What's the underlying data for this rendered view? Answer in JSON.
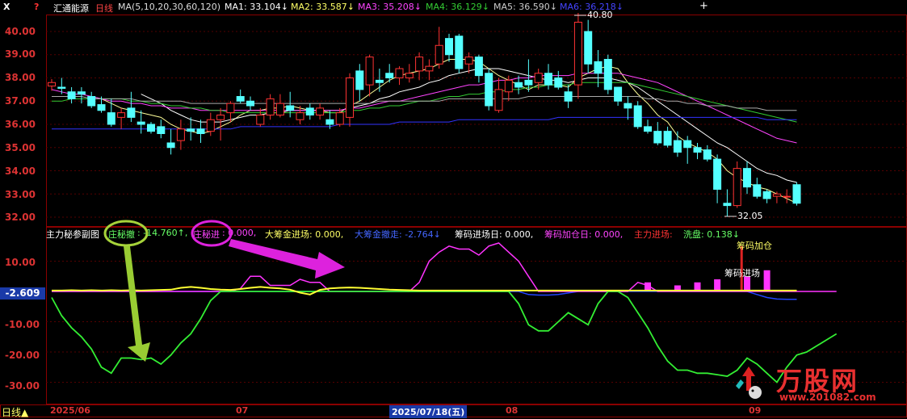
{
  "header": {
    "stock_name": "汇通能源",
    "period": "日线",
    "ma_params": "MA(5,10,20,30,60,120)",
    "ma1": "MA1: 33.104↓",
    "ma2": "MA2: 33.587↓",
    "ma3": "MA3: 35.208↓",
    "ma4": "MA4: 36.129↓",
    "ma5": "MA5: 36.590↓",
    "ma6": "MA6: 36.218↓",
    "colors": {
      "ma1": "#ffff99",
      "ma2": "#ffffff",
      "ma3": "#ff44ff",
      "ma4": "#33cc33",
      "ma5": "#aaaaaa",
      "ma6": "#3333ff"
    }
  },
  "price_axis": [
    "40.00",
    "39.00",
    "38.00",
    "37.00",
    "36.00",
    "35.00",
    "34.00",
    "33.00",
    "32.00"
  ],
  "indicator_axis": [
    "10.00",
    "-10.00",
    "-20.00",
    "-30.00"
  ],
  "current_value": "-2.609",
  "annotations": {
    "high": "40.80",
    "low": "32.05"
  },
  "indicator_header": {
    "name": "主力秘参副图",
    "zhuang_che_label": "庄秘撤",
    "zhuang_che_value": ": -14.760↑,",
    "zhuang_jin_label": "庄秘进",
    "zhuang_jin_value": ": 0.000,",
    "big_in": "大筹金进场: 0.000,",
    "big_out": "大筹金撤走: -2.764↓",
    "chip_day": "筹码进场日: 0.000,",
    "chip_add": "筹码加仓日: 0.000,",
    "main_in": "主力进场: ",
    "wash": "洗盘: 0.138↓"
  },
  "callouts": {
    "chip_add": "筹码加仓",
    "chip_in": "筹码进场"
  },
  "bottom": {
    "period_button": "日线▲",
    "dates": [
      "2025/06",
      "07",
      "2025/07/18(五)",
      "08",
      "09"
    ]
  },
  "watermark": {
    "brand": "万股网",
    "url": "www.201082.com"
  },
  "chart_data": {
    "type": "candlestick",
    "ylim": [
      31.8,
      41.0
    ],
    "candles": [
      [
        37.65,
        37.95,
        37.45,
        37.8
      ],
      [
        37.6,
        38.0,
        37.3,
        37.55
      ],
      [
        37.4,
        37.6,
        36.9,
        37.1
      ],
      [
        37.4,
        37.6,
        36.9,
        37.3
      ],
      [
        37.2,
        37.4,
        36.7,
        36.8
      ],
      [
        36.85,
        37.2,
        36.5,
        36.6
      ],
      [
        36.5,
        37.1,
        35.9,
        36.0
      ],
      [
        36.3,
        36.7,
        35.8,
        36.5
      ],
      [
        36.7,
        37.4,
        36.1,
        36.3
      ],
      [
        36.1,
        36.6,
        35.6,
        36.0
      ],
      [
        36.0,
        36.1,
        35.6,
        35.7
      ],
      [
        35.9,
        36.2,
        35.4,
        35.6
      ],
      [
        35.2,
        35.8,
        34.7,
        35.0
      ],
      [
        35.3,
        36.2,
        34.9,
        35.8
      ],
      [
        35.8,
        36.3,
        35.3,
        35.7
      ],
      [
        35.8,
        36.2,
        35.2,
        35.6
      ],
      [
        35.7,
        36.5,
        35.5,
        36.2
      ],
      [
        36.2,
        36.7,
        35.3,
        36.4
      ],
      [
        36.5,
        37.0,
        36.1,
        36.9
      ],
      [
        37.2,
        37.5,
        36.9,
        37.0
      ],
      [
        37.0,
        37.2,
        36.6,
        36.8
      ],
      [
        36.0,
        36.7,
        35.9,
        36.4
      ],
      [
        36.4,
        37.3,
        36.2,
        37.1
      ],
      [
        36.4,
        37.3,
        36.3,
        36.9
      ],
      [
        36.8,
        37.4,
        36.3,
        36.6
      ],
      [
        36.2,
        36.8,
        36.0,
        36.5
      ],
      [
        36.7,
        36.9,
        36.2,
        36.4
      ],
      [
        36.4,
        36.9,
        36.2,
        36.7
      ],
      [
        36.2,
        36.6,
        35.8,
        36.0
      ],
      [
        36.0,
        36.7,
        35.9,
        36.5
      ],
      [
        36.3,
        38.2,
        35.9,
        38.0
      ],
      [
        38.3,
        38.6,
        37.0,
        37.5
      ],
      [
        37.7,
        39.0,
        37.2,
        38.9
      ],
      [
        37.9,
        38.4,
        37.4,
        37.8
      ],
      [
        38.2,
        38.6,
        37.8,
        38.0
      ],
      [
        38.0,
        38.5,
        37.7,
        38.4
      ],
      [
        38.0,
        38.6,
        37.8,
        38.2
      ],
      [
        38.3,
        39.1,
        37.9,
        38.9
      ],
      [
        38.3,
        38.8,
        37.9,
        38.5
      ],
      [
        38.6,
        40.2,
        38.4,
        39.4
      ],
      [
        39.7,
        39.9,
        38.7,
        39.0
      ],
      [
        39.8,
        39.9,
        38.2,
        38.4
      ],
      [
        38.6,
        39.1,
        38.2,
        38.9
      ],
      [
        38.9,
        39.0,
        37.8,
        38.1
      ],
      [
        38.2,
        38.4,
        36.6,
        36.8
      ],
      [
        36.6,
        38.0,
        36.5,
        37.5
      ],
      [
        37.4,
        38.1,
        37.0,
        37.9
      ],
      [
        37.8,
        38.1,
        37.3,
        37.6
      ],
      [
        37.9,
        38.8,
        37.4,
        37.7
      ],
      [
        37.8,
        38.4,
        37.5,
        38.2
      ],
      [
        38.2,
        38.6,
        37.5,
        37.7
      ],
      [
        38.0,
        38.3,
        37.5,
        37.6
      ],
      [
        37.4,
        37.7,
        36.7,
        37.0
      ],
      [
        37.7,
        40.8,
        37.1,
        40.4
      ],
      [
        40.0,
        40.5,
        38.2,
        38.6
      ],
      [
        38.7,
        39.2,
        37.6,
        38.2
      ],
      [
        38.8,
        39.0,
        37.3,
        37.5
      ],
      [
        37.6,
        37.6,
        36.8,
        37.0
      ],
      [
        36.9,
        37.2,
        36.2,
        36.7
      ],
      [
        36.8,
        37.0,
        35.8,
        35.9
      ],
      [
        35.9,
        36.2,
        35.6,
        35.7
      ],
      [
        35.7,
        36.1,
        35.1,
        35.2
      ],
      [
        35.7,
        35.9,
        35.0,
        35.1
      ],
      [
        35.3,
        35.7,
        34.6,
        34.8
      ],
      [
        35.3,
        35.5,
        34.3,
        35.0
      ],
      [
        35.0,
        35.2,
        34.5,
        34.8
      ],
      [
        34.9,
        35.1,
        34.4,
        34.5
      ],
      [
        34.5,
        34.7,
        32.6,
        33.2
      ],
      [
        32.6,
        33.2,
        32.05,
        32.5
      ],
      [
        32.5,
        34.4,
        32.4,
        34.1
      ],
      [
        34.1,
        34.4,
        33.0,
        33.3
      ],
      [
        33.4,
        33.7,
        32.8,
        32.9
      ],
      [
        33.1,
        33.2,
        32.6,
        32.8
      ],
      [
        32.9,
        33.1,
        32.6,
        33.0
      ],
      [
        32.9,
        33.2,
        32.6,
        32.9
      ],
      [
        33.4,
        33.5,
        32.5,
        32.6
      ]
    ],
    "ma_series": {
      "ma1": [
        null,
        null,
        null,
        null,
        37.2,
        37.1,
        36.9,
        36.7,
        36.6,
        36.5,
        36.4,
        36.3,
        36.0,
        35.8,
        35.7,
        35.6,
        35.7,
        35.9,
        36.1,
        36.4,
        36.6,
        36.6,
        36.7,
        36.7,
        36.8,
        36.7,
        36.6,
        36.6,
        36.5,
        36.5,
        36.8,
        37.0,
        37.3,
        37.6,
        37.9,
        38.1,
        38.2,
        38.3,
        38.4,
        38.6,
        38.8,
        38.8,
        38.8,
        38.7,
        38.4,
        38.1,
        37.9,
        37.7,
        37.5,
        37.7,
        37.7,
        37.7,
        37.6,
        38.0,
        38.2,
        38.4,
        38.5,
        38.4,
        37.8,
        37.3,
        36.9,
        36.4,
        36.1,
        35.5,
        35.2,
        35.0,
        34.8,
        34.5,
        34.0,
        33.7,
        33.5,
        33.3,
        33.2,
        33.0,
        32.8,
        32.6
      ],
      "ma2": [
        null,
        null,
        null,
        null,
        null,
        null,
        null,
        null,
        null,
        37.3,
        37.1,
        36.9,
        36.6,
        36.4,
        36.2,
        36.1,
        36.1,
        36.1,
        36.2,
        36.3,
        36.4,
        36.4,
        36.5,
        36.5,
        36.6,
        36.6,
        36.6,
        36.6,
        36.6,
        36.6,
        36.7,
        36.8,
        36.9,
        37.1,
        37.2,
        37.4,
        37.5,
        37.6,
        37.8,
        37.9,
        38.1,
        38.2,
        38.3,
        38.4,
        38.4,
        38.4,
        38.3,
        38.2,
        38.1,
        38.0,
        37.9,
        37.9,
        37.8,
        37.9,
        38.0,
        38.0,
        38.0,
        37.9,
        37.8,
        37.6,
        37.3,
        37.0,
        36.7,
        36.4,
        36.1,
        35.8,
        35.5,
        35.2,
        35.0,
        34.7,
        34.4,
        34.1,
        33.9,
        33.8,
        33.6,
        33.5
      ],
      "ma3": [
        37.5,
        37.4,
        37.3,
        37.3,
        37.2,
        37.1,
        37.0,
        37.0,
        36.9,
        36.9,
        36.8,
        36.8,
        36.7,
        36.7,
        36.7,
        36.6,
        36.6,
        36.6,
        36.6,
        36.6,
        36.6,
        36.6,
        36.6,
        36.6,
        36.6,
        36.6,
        36.6,
        36.6,
        36.6,
        36.6,
        36.7,
        36.7,
        36.8,
        36.9,
        37.0,
        37.0,
        37.1,
        37.2,
        37.3,
        37.4,
        37.5,
        37.6,
        37.7,
        37.7,
        37.8,
        37.9,
        37.9,
        38.0,
        38.0,
        38.1,
        38.1,
        38.1,
        38.1,
        38.2,
        38.2,
        38.2,
        38.2,
        38.2,
        38.1,
        38.0,
        37.9,
        37.8,
        37.6,
        37.4,
        37.2,
        37.0,
        36.8,
        36.6,
        36.4,
        36.2,
        36.0,
        35.8,
        35.6,
        35.4,
        35.3,
        35.2
      ],
      "ma4": [
        37.0,
        37.0,
        37.1,
        37.1,
        37.1,
        37.1,
        37.1,
        37.1,
        37.0,
        37.0,
        36.9,
        36.9,
        36.8,
        36.8,
        36.7,
        36.7,
        36.6,
        36.6,
        36.5,
        36.5,
        36.5,
        36.5,
        36.5,
        36.5,
        36.5,
        36.5,
        36.5,
        36.5,
        36.5,
        36.5,
        36.6,
        36.6,
        36.7,
        36.7,
        36.8,
        36.8,
        36.9,
        37.0,
        37.0,
        37.1,
        37.2,
        37.2,
        37.3,
        37.3,
        37.4,
        37.4,
        37.5,
        37.5,
        37.6,
        37.6,
        37.7,
        37.7,
        37.7,
        37.8,
        37.8,
        37.8,
        37.8,
        37.8,
        37.8,
        37.7,
        37.6,
        37.5,
        37.4,
        37.3,
        37.2,
        37.1,
        37.0,
        36.9,
        36.8,
        36.7,
        36.6,
        36.5,
        36.4,
        36.3,
        36.2,
        36.1
      ],
      "ma5": [
        37.2,
        37.2,
        37.2,
        37.2,
        37.1,
        37.1,
        37.1,
        37.1,
        37.1,
        37.0,
        37.0,
        37.0,
        37.0,
        37.0,
        36.9,
        36.9,
        36.9,
        36.9,
        36.9,
        36.9,
        36.9,
        36.9,
        36.9,
        36.9,
        36.9,
        36.9,
        36.9,
        36.9,
        36.9,
        36.9,
        36.9,
        36.9,
        36.9,
        37.0,
        37.0,
        37.0,
        37.0,
        37.0,
        37.0,
        37.0,
        37.1,
        37.1,
        37.1,
        37.1,
        37.1,
        37.1,
        37.1,
        37.1,
        37.2,
        37.2,
        37.2,
        37.2,
        37.2,
        37.2,
        37.2,
        37.2,
        37.2,
        37.2,
        37.2,
        37.2,
        37.1,
        37.1,
        37.0,
        37.0,
        36.9,
        36.9,
        36.8,
        36.8,
        36.8,
        36.7,
        36.7,
        36.7,
        36.6,
        36.6,
        36.6,
        36.6
      ],
      "ma6": [
        35.8,
        35.8,
        35.8,
        35.8,
        35.8,
        35.8,
        35.8,
        35.8,
        35.8,
        35.8,
        35.8,
        35.8,
        35.8,
        35.8,
        35.8,
        35.8,
        35.8,
        35.8,
        35.8,
        35.9,
        35.9,
        35.9,
        35.9,
        35.9,
        35.9,
        35.9,
        35.9,
        35.9,
        35.9,
        36.0,
        36.0,
        36.0,
        36.0,
        36.0,
        36.0,
        36.1,
        36.1,
        36.1,
        36.1,
        36.1,
        36.1,
        36.2,
        36.2,
        36.2,
        36.2,
        36.2,
        36.2,
        36.2,
        36.2,
        36.2,
        36.2,
        36.3,
        36.3,
        36.3,
        36.3,
        36.3,
        36.3,
        36.3,
        36.3,
        36.3,
        36.3,
        36.3,
        36.3,
        36.3,
        36.3,
        36.3,
        36.3,
        36.3,
        36.3,
        36.3,
        36.3,
        36.3,
        36.2,
        36.2,
        36.2,
        36.2
      ]
    },
    "indicator": {
      "ylim": [
        -33,
        16
      ],
      "green": [
        -2,
        -8,
        -12,
        -15,
        -19,
        -25,
        -27,
        -22,
        -22,
        -22.5,
        -22,
        -24,
        -21,
        -17,
        -14,
        -9,
        -3,
        0,
        0,
        0,
        0,
        0,
        0,
        0,
        0,
        0,
        0,
        0,
        0,
        0,
        0,
        0,
        0,
        0,
        0,
        0,
        0,
        0,
        0,
        0,
        0,
        0,
        0,
        0,
        0,
        0,
        0,
        -4,
        -11,
        -13,
        -13,
        -10,
        -7,
        -9,
        -11,
        -4,
        0,
        0,
        -2,
        -7,
        -12,
        -18,
        -23,
        -26,
        -26,
        -27,
        -27,
        -27.5,
        -28,
        -26,
        -22,
        -24,
        -27,
        -30,
        -25,
        -21,
        -20,
        -18,
        -16,
        -14
      ],
      "magenta": [
        0,
        0,
        0,
        0,
        0,
        0,
        0,
        0,
        0,
        0,
        0,
        0,
        0,
        0,
        0,
        0,
        0,
        0,
        0,
        1,
        5,
        5,
        2,
        2,
        2,
        4,
        3,
        3,
        0,
        0,
        0,
        0,
        0,
        0,
        0,
        0,
        0,
        3,
        10,
        13,
        15,
        14,
        14,
        12,
        15,
        16,
        13,
        10,
        5,
        0,
        0,
        0,
        0,
        0,
        0,
        0,
        0,
        0,
        0,
        3,
        2,
        0,
        0,
        0,
        0,
        0,
        0,
        0,
        0,
        0,
        0,
        0,
        0,
        0,
        0,
        0,
        0,
        0,
        0,
        0
      ],
      "yellow": [
        0.3,
        0.3,
        0.4,
        0.3,
        0.4,
        0.3,
        0.4,
        0.3,
        0.4,
        0.3,
        0.4,
        0.5,
        0.6,
        1.2,
        1.5,
        1.2,
        0.8,
        0.6,
        0.5,
        0.8,
        1.2,
        1.5,
        1.2,
        1.0,
        0.6,
        -0.4,
        -1.0,
        0.5,
        1.0,
        1.2,
        1.3,
        1.2,
        1.0,
        0.8,
        0.6,
        0.5,
        0.4,
        0.3,
        0.3,
        0.3,
        0.3,
        0.3,
        0.3,
        0.3,
        0.3,
        0.3,
        0.3,
        0.3,
        0.3,
        0.3,
        0.3,
        0.3,
        0.3,
        0.3,
        0.3,
        0.3,
        0.3,
        0.3,
        0.3,
        0.3,
        0.3,
        0.3,
        0.3,
        0.3,
        0.3,
        0.3,
        0.3,
        0.3,
        0.3,
        0.3,
        0.3,
        0.3,
        0.3,
        0.3,
        0.3,
        0.3
      ],
      "blue": [
        0,
        0,
        0,
        0,
        0,
        0,
        0,
        0,
        0,
        0,
        0,
        0,
        0,
        0,
        0,
        0,
        0,
        0,
        0,
        0,
        0,
        0,
        0,
        0,
        0,
        0,
        0,
        0,
        0,
        0,
        0,
        0,
        0,
        0,
        0,
        0,
        0,
        0,
        0,
        0,
        0,
        0,
        0,
        0,
        0,
        0,
        0,
        0,
        -1,
        -1.2,
        -1.2,
        -1,
        -0.5,
        0,
        0,
        0,
        0,
        0,
        0,
        0,
        0,
        0,
        0,
        0,
        0,
        0,
        0,
        0,
        0,
        0,
        0,
        -1,
        -2,
        -2.5,
        -2.6,
        -2.6
      ],
      "bars": [
        {
          "i": 60,
          "v": 3
        },
        {
          "i": 63,
          "v": 2
        },
        {
          "i": 65,
          "v": 3
        },
        {
          "i": 67,
          "v": 4
        },
        {
          "i": 70,
          "v": 5
        },
        {
          "i": 72,
          "v": 7
        }
      ]
    }
  }
}
